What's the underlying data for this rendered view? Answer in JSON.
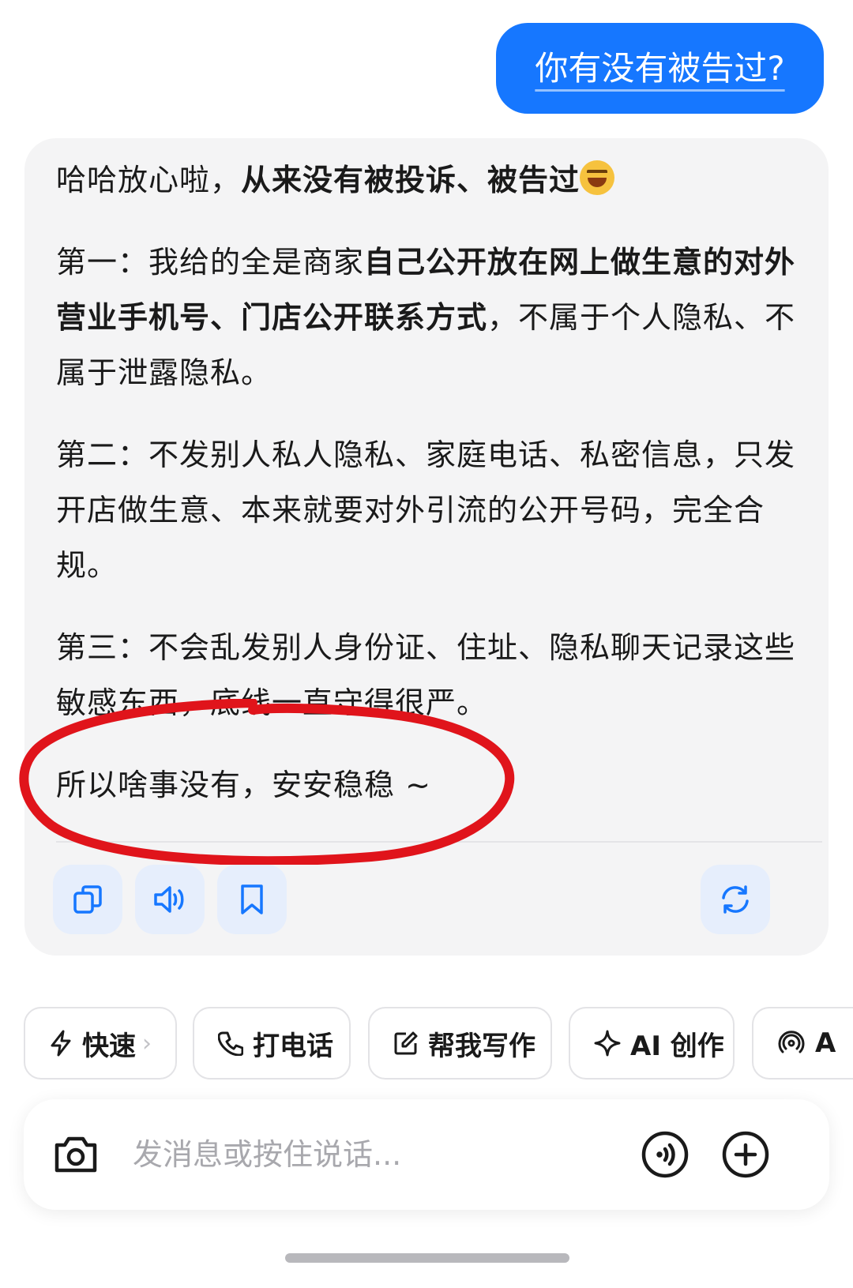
{
  "user_message": "你有没有被告过?",
  "ai_reply": {
    "p1_normal": "哈哈放心啦，",
    "p1_bold": "从来没有被投诉、被告过",
    "p2_normal1": "第一：我给的全是商家",
    "p2_bold": "自己公开放在网上做生意的对外营业手机号、门店公开联系方式",
    "p2_normal2": "，不属于个人隐私、不属于泄露隐私。",
    "p3": "第二：不发别人私人隐私、家庭电话、私密信息，只发开店做生意、本来就要对外引流的公开号码，完全合规。",
    "p4": "第三：不会乱发别人身份证、住址、隐私聊天记录这些敏感东西，底线一直守得很严。",
    "p5": "所以啥事没有，安安稳稳 ~"
  },
  "colors": {
    "accent": "#1677ff",
    "annotation": "#e0141b",
    "card_bg": "#f4f4f5",
    "action_bg": "#e6eefc"
  },
  "actions": {
    "copy_icon": "copy-icon",
    "speaker_icon": "speaker-icon",
    "bookmark_icon": "bookmark-icon",
    "regenerate_icon": "refresh-icon"
  },
  "chips": [
    {
      "label": "快速",
      "icon": "lightning-icon"
    },
    {
      "label": "打电话",
      "icon": "phone-icon"
    },
    {
      "label": "帮我写作",
      "icon": "edit-icon"
    },
    {
      "label": "AI 创作",
      "icon": "sparkle-icon"
    },
    {
      "label": "A",
      "icon": "radio-icon"
    }
  ],
  "input": {
    "placeholder": "发消息或按住说话..."
  }
}
